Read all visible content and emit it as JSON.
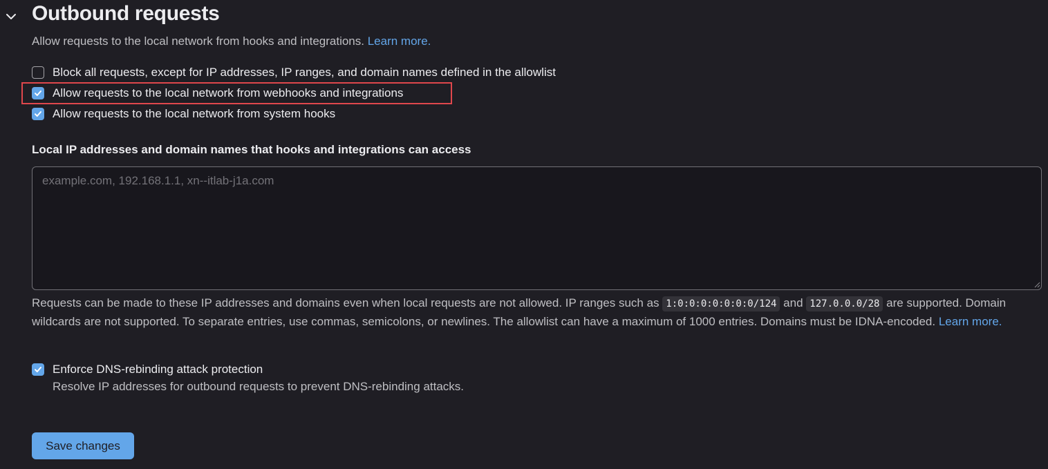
{
  "section": {
    "title": "Outbound requests",
    "description": "Allow requests to the local network from hooks and integrations.",
    "learn_more": "Learn more."
  },
  "checkboxes": [
    {
      "label": "Block all requests, except for IP addresses, IP ranges, and domain names defined in the allowlist",
      "checked": false
    },
    {
      "label": "Allow requests to the local network from webhooks and integrations",
      "checked": true
    },
    {
      "label": "Allow requests to the local network from system hooks",
      "checked": true
    }
  ],
  "allowlist": {
    "label": "Local IP addresses and domain names that hooks and integrations can access",
    "placeholder": "example.com, 192.168.1.1, xn--itlab-j1a.com",
    "value": ""
  },
  "help": {
    "part1": "Requests can be made to these IP addresses and domains even when local requests are not allowed. IP ranges such as",
    "code1": "1:0:0:0:0:0:0:0/124",
    "part2": "and",
    "code2": "127.0.0.0/28",
    "part3": "are supported. Domain wildcards are not supported. To separate entries, use commas, semicolons, or newlines. The allowlist can have a maximum of 1000 entries. Domains must be IDNA-encoded.",
    "learn_more": "Learn more."
  },
  "dns_rebinding": {
    "label": "Enforce DNS-rebinding attack protection",
    "description": "Resolve IP addresses for outbound requests to prevent DNS-rebinding attacks.",
    "checked": true
  },
  "save_button": "Save changes",
  "colors": {
    "background": "#1f1e24",
    "accent": "#63a6e9",
    "highlight_border": "#e0474c"
  },
  "icons": {
    "collapse": "chevron-down-icon",
    "check": "checkmark-icon",
    "resize": "resize-grip-icon"
  }
}
